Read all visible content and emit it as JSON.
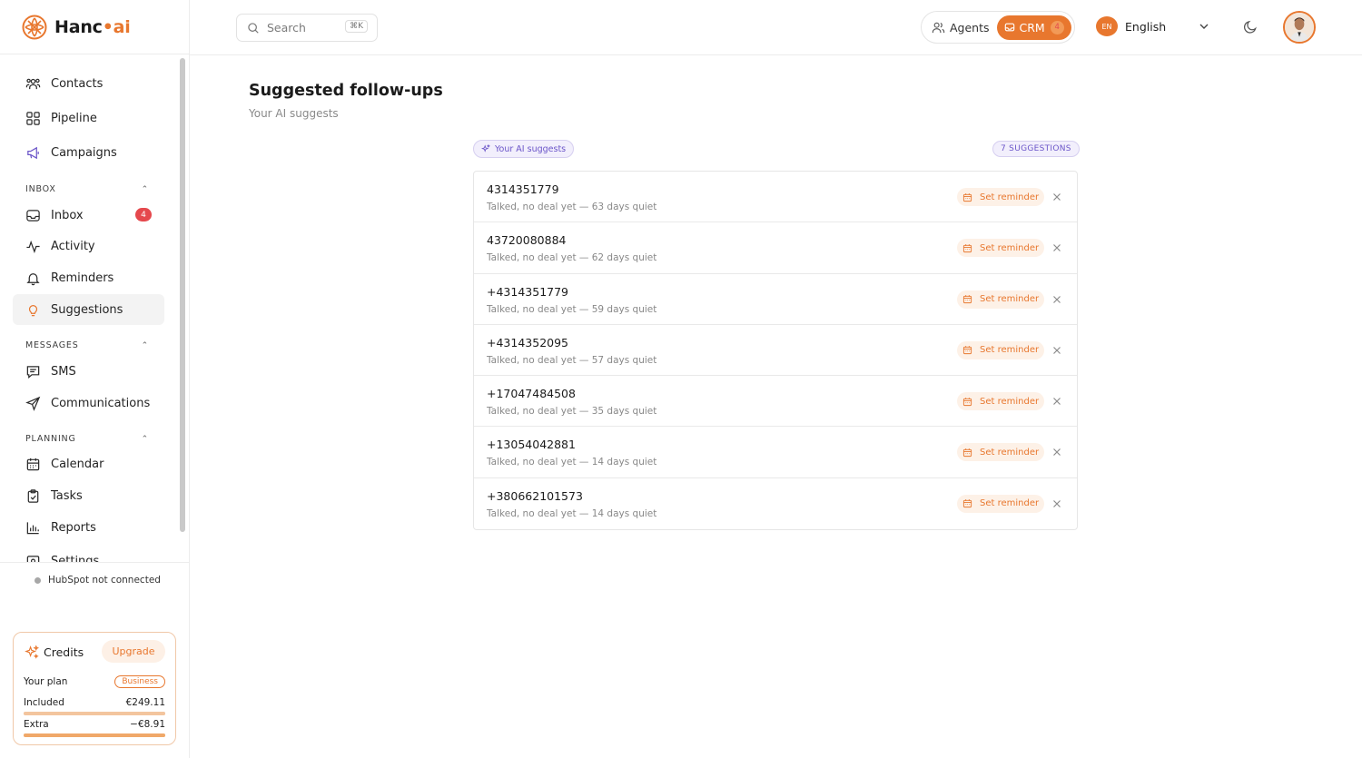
{
  "brand": {
    "name_main": "Hanc",
    "name_dot": "•",
    "name_tail": "ai"
  },
  "sidebar": {
    "top_items": [
      {
        "label": "Contacts",
        "icon": "contacts-icon"
      },
      {
        "label": "Pipeline",
        "icon": "pipeline-icon"
      },
      {
        "label": "Campaigns",
        "icon": "megaphone-icon"
      }
    ],
    "sections": [
      {
        "title": "INBOX",
        "items": [
          {
            "label": "Inbox",
            "badge": "4"
          },
          {
            "label": "Activity"
          },
          {
            "label": "Reminders"
          },
          {
            "label": "Suggestions",
            "active": true
          }
        ]
      },
      {
        "title": "MESSAGES",
        "items": [
          {
            "label": "SMS"
          },
          {
            "label": "Communications"
          }
        ]
      },
      {
        "title": "PLANNING",
        "items": [
          {
            "label": "Calendar"
          },
          {
            "label": "Tasks"
          },
          {
            "label": "Reports"
          },
          {
            "label": "Settings"
          }
        ]
      }
    ],
    "hubspot_status": "HubSpot not connected",
    "credits": {
      "title": "Credits",
      "upgrade_label": "Upgrade",
      "plan_label": "Your plan",
      "plan_name": "Business",
      "included_label": "Included",
      "included_value": "€249.11",
      "included_fill": 1.0,
      "extra_label": "Extra",
      "extra_value": "−€8.91",
      "extra_fill": 1.0
    }
  },
  "topbar": {
    "search_placeholder": "Search",
    "search_shortcut": "⌘K",
    "agents_label": "Agents",
    "crm_label": "CRM",
    "crm_count": "4",
    "lang_code": "EN",
    "lang_label": "English"
  },
  "main": {
    "title": "Suggested follow-ups",
    "subtitle": "Your AI suggests",
    "ai_pill": "Your AI suggests",
    "count_pill": "7 SUGGESTIONS",
    "reminder_label": "Set reminder",
    "suggestions": [
      {
        "phone": "4314351779",
        "meta": "Talked, no deal yet — 63 days quiet"
      },
      {
        "phone": "43720080884",
        "meta": "Talked, no deal yet — 62 days quiet"
      },
      {
        "phone": "+4314351779",
        "meta": "Talked, no deal yet — 59 days quiet"
      },
      {
        "phone": "+4314352095",
        "meta": "Talked, no deal yet — 57 days quiet"
      },
      {
        "phone": "+17047484508",
        "meta": "Talked, no deal yet — 35 days quiet"
      },
      {
        "phone": "+13054042881",
        "meta": "Talked, no deal yet — 14 days quiet"
      },
      {
        "phone": "+380662101573",
        "meta": "Talked, no deal yet — 14 days quiet"
      }
    ]
  },
  "colors": {
    "accent": "#e8772e",
    "ai_purple": "#6b55c9",
    "badge_red": "#e5484d"
  }
}
